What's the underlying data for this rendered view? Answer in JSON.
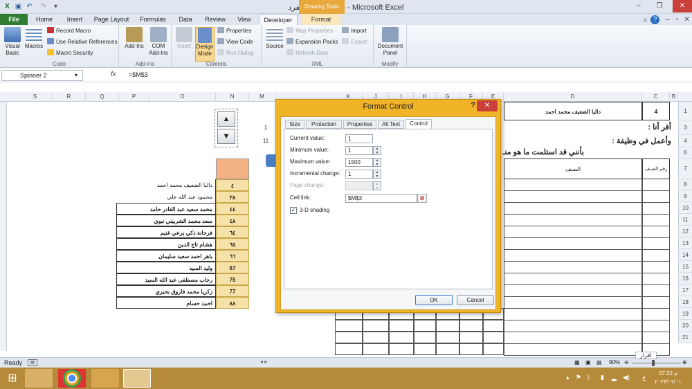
{
  "window": {
    "title": "طباعة الكل ومفرد - Microsoft Excel",
    "contextual_tab_group": "Drawing Tools"
  },
  "ribbon_tabs": [
    "File",
    "Home",
    "Insert",
    "Page Layout",
    "Formulas",
    "Data",
    "Review",
    "View",
    "Developer",
    "Format"
  ],
  "active_tab": "Developer",
  "ribbon": {
    "code": {
      "label": "Code",
      "visual_basic": "Visual Basic",
      "macros": "Macros",
      "record_macro": "Record Macro",
      "use_relative": "Use Relative References",
      "macro_security": "Macro Security"
    },
    "addins": {
      "label": "Add-Ins",
      "addins": "Add-Ins",
      "com_addins": "COM Add-Ins"
    },
    "controls": {
      "label": "Controls",
      "insert": "Insert",
      "design_mode": "Design Mode",
      "properties": "Properties",
      "view_code": "View Code",
      "run_dialog": "Run Dialog"
    },
    "xml": {
      "label": "XML",
      "source": "Source",
      "map_properties": "Map Properties",
      "expansion_packs": "Expansion Packs",
      "refresh_data": "Refresh Data",
      "import": "Import",
      "export": "Export"
    },
    "modify": {
      "label": "Modify",
      "document_panel": "Document Panel"
    }
  },
  "formula_bar": {
    "name_box": "Spinner 2",
    "fx": "fx",
    "formula": "=$M$3"
  },
  "columns_left": [
    "S",
    "R",
    "Q",
    "P",
    "O",
    "N",
    "M"
  ],
  "columns_right": [
    "K",
    "J",
    "I",
    "H",
    "G",
    "F",
    "E",
    "D",
    "C",
    "B"
  ],
  "rows": [
    "1",
    "3",
    "4",
    "6",
    "7",
    "8",
    "9",
    "10",
    "11",
    "12",
    "13",
    "14",
    "15",
    "16",
    "17",
    "18",
    "19",
    "20",
    "21"
  ],
  "cells": {
    "m3": "1",
    "m4": "11",
    "d1": "داليا الضعيف محمد احمد",
    "c1": "4",
    "row3": "أقر أنا :",
    "row4": "وأعمل في وظيفة :",
    "row6": "بأنني قد استلمت ما هو منـ",
    "d7": "الصنف",
    "c7": "رقم الصنف"
  },
  "list_rows": [
    {
      "name": "داليا الضعيف محمد احمد",
      "num": "٤"
    },
    {
      "name": "محمود عبد الله علي",
      "num": "٣٨"
    },
    {
      "name": "محمد سعيد عبد القادر حامد",
      "num": "٤٤"
    },
    {
      "name": "سعد محمد الشربيني نبوي",
      "num": "٤٨"
    },
    {
      "name": "فرحانة ذكي يرعي غنيم",
      "num": "٦٤"
    },
    {
      "name": "هشام تاج الدين",
      "num": "٦٥"
    },
    {
      "name": "باهر احمد سعيد سليمان",
      "num": "٦٦"
    },
    {
      "name": "وليد السيد",
      "num": "67"
    },
    {
      "name": "رحاب مصطفى عبد الله السيد",
      "num": "75"
    },
    {
      "name": "زكريا محمد فاروق بحيري",
      "num": "77"
    },
    {
      "name": "احمد حسام",
      "num": "٨٨"
    }
  ],
  "dialog": {
    "title": "Format Control",
    "help": "?",
    "close": "✕",
    "tabs": [
      "Size",
      "Protection",
      "Properties",
      "Alt Text",
      "Control"
    ],
    "active_tab": "Control",
    "current_value_label": "Current value:",
    "current_value": "1",
    "minimum_value_label": "Minimum value:",
    "minimum_value": "1",
    "maximum_value_label": "Maximum value:",
    "maximum_value": "1500",
    "incremental_change_label": "Incremental change:",
    "incremental_change": "1",
    "page_change_label": "Page change:",
    "page_change": "",
    "cell_link_label": "Cell link:",
    "cell_link": "$M$3",
    "shading_label": "3-D shading",
    "shading_checked": true,
    "ok": "OK",
    "cancel": "Cancel"
  },
  "status_bar": {
    "ready": "Ready",
    "sheet_tab": "اقرار",
    "zoom": "90%"
  },
  "taskbar": {
    "time": "07:22 م",
    "date": "٢٠٢٣/٠٢/٠١",
    "lang": "ع"
  },
  "colors": {
    "accent_orange": "#f0b429",
    "excel_green": "#2e7d32",
    "highlight_cell": "#f6e2a8",
    "header_cell": "#f4b183"
  }
}
